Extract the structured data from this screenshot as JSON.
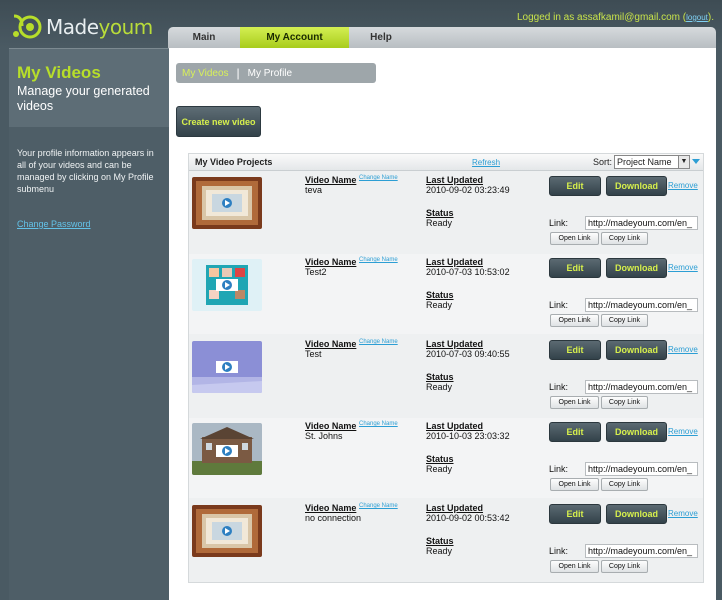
{
  "brand": {
    "name_part1": "Made",
    "name_part2": "youm"
  },
  "session": {
    "prefix": "Logged in as",
    "email": "assafkamil@gmail.com",
    "logout_label": "logout"
  },
  "nav": {
    "tabs": [
      {
        "label": "Main",
        "active": false
      },
      {
        "label": "My Account",
        "active": true
      },
      {
        "label": "Help",
        "active": false
      }
    ]
  },
  "sidebar": {
    "title": "My Videos",
    "subtitle": "Manage your generated videos",
    "description": "Your profile information appears in all of your videos and can be managed by clicking on My Profile submenu",
    "change_password": "Change Password"
  },
  "subnav": {
    "active": "My Videos",
    "separator": "|",
    "other": "My Profile"
  },
  "create_button": "Create new video",
  "projects": {
    "title": "My Video Projects",
    "refresh": "Refresh",
    "sort_label": "Sort:",
    "sort_value": "Project Name",
    "labels": {
      "video_name": "Video Name",
      "change_name": "Change Name",
      "last_updated": "Last Updated",
      "status": "Status",
      "edit": "Edit",
      "download": "Download",
      "remove": "Remove",
      "link": "Link:",
      "open_link": "Open Link",
      "copy_link": "Copy Link"
    },
    "items": [
      {
        "name": "teva",
        "last_updated": "2010-09-02 03:23:49",
        "status": "Ready",
        "link": "http://madeyoum.com/en_",
        "thumbnail": "framed-room-icon"
      },
      {
        "name": "Test2",
        "last_updated": "2010-07-03 10:53:02",
        "status": "Ready",
        "link": "http://madeyoum.com/en_",
        "thumbnail": "collage-icon"
      },
      {
        "name": "Test",
        "last_updated": "2010-07-03 09:40:55",
        "status": "Ready",
        "link": "http://madeyoum.com/en_",
        "thumbnail": "sky-scene-icon"
      },
      {
        "name": "St. Johns",
        "last_updated": "2010-10-03 23:03:32",
        "status": "Ready",
        "link": "http://madeyoum.com/en_",
        "thumbnail": "house-icon"
      },
      {
        "name": "no connection",
        "last_updated": "2010-09-02 00:53:42",
        "status": "Ready",
        "link": "http://madeyoum.com/en_",
        "thumbnail": "framed-room-icon"
      }
    ]
  },
  "colors": {
    "accent_green": "#b7de2a",
    "link_blue": "#2c9ed4",
    "dark_bg": "#4a5a63"
  }
}
